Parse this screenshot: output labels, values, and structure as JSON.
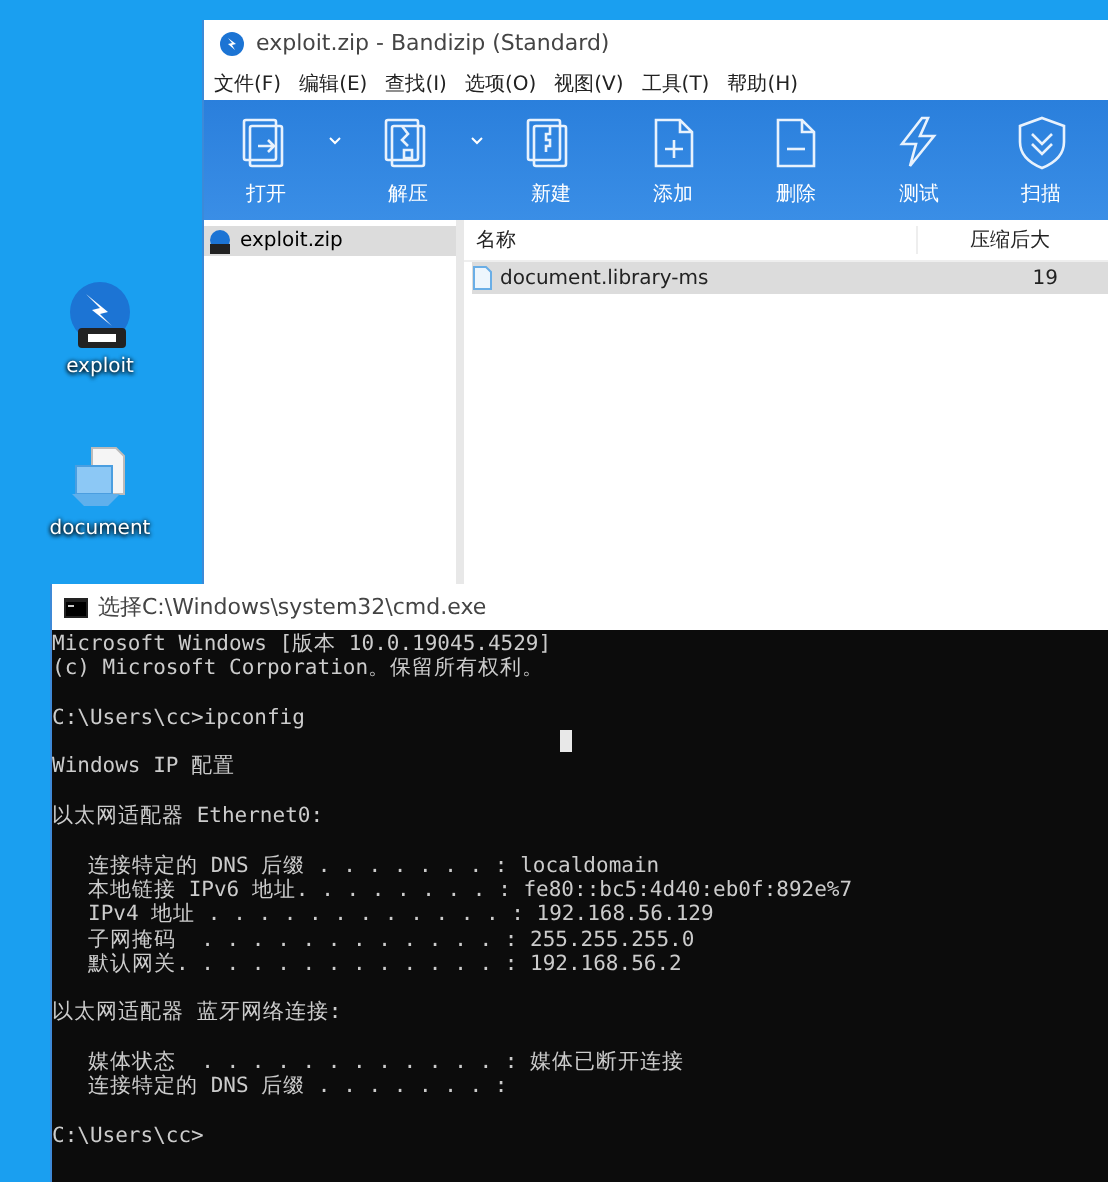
{
  "desktop_icons": [
    {
      "kind": "zip",
      "label": "exploit"
    },
    {
      "kind": "document",
      "label": "document"
    }
  ],
  "bandizip": {
    "title": "exploit.zip - Bandizip (Standard)",
    "menu": [
      "文件(F)",
      "编辑(E)",
      "查找(I)",
      "选项(O)",
      "视图(V)",
      "工具(T)",
      "帮助(H)"
    ],
    "toolbar": [
      {
        "kind": "open",
        "label": "打开",
        "dropdown": true
      },
      {
        "kind": "extract",
        "label": "解压",
        "dropdown": true
      },
      {
        "kind": "new",
        "label": "新建",
        "dropdown": false
      },
      {
        "kind": "add",
        "label": "添加",
        "dropdown": false
      },
      {
        "kind": "delete",
        "label": "删除",
        "dropdown": false
      },
      {
        "kind": "test",
        "label": "测试",
        "dropdown": false
      },
      {
        "kind": "scan",
        "label": "扫描",
        "dropdown": false
      }
    ],
    "tree": [
      {
        "label": "exploit.zip",
        "selected": true
      }
    ],
    "columns": [
      "名称",
      "压缩后大"
    ],
    "rows": [
      {
        "name": "document.library-ms",
        "size": "19",
        "selected": true
      }
    ]
  },
  "cmd": {
    "title": "选择C:\\Windows\\system32\\cmd.exe",
    "blocks": [
      {
        "kind": "text",
        "lines": [
          "Microsoft Windows [版本 10.0.19045.4529]",
          "(c) Microsoft Corporation。保留所有权利。"
        ]
      },
      {
        "kind": "text",
        "lines": [
          "C:\\Users\\cc>ipconfig"
        ]
      },
      {
        "kind": "text",
        "lines": [
          "Windows IP 配置"
        ]
      },
      {
        "kind": "heading",
        "lines": [
          "以太网适配器 Ethernet0:"
        ]
      },
      {
        "kind": "entries",
        "lines": [
          "连接特定的 DNS 后缀 . . . . . . . : localdomain",
          "本地链接 IPv6 地址. . . . . . . . : fe80::bc5:4d40:eb0f:892e%7",
          "IPv4 地址 . . . . . . . . . . . . : 192.168.56.129",
          "子网掩码  . . . . . . . . . . . . : 255.255.255.0",
          "默认网关. . . . . . . . . . . . . : 192.168.56.2"
        ]
      },
      {
        "kind": "text",
        "lines": [
          "以太网适配器 蓝牙网络连接:"
        ]
      },
      {
        "kind": "entries",
        "lines": [
          "媒体状态  . . . . . . . . . . . . : 媒体已断开连接",
          "连接特定的 DNS 后缀 . . . . . . . :"
        ]
      },
      {
        "kind": "text",
        "lines": [
          "C:\\Users\\cc>"
        ]
      }
    ]
  }
}
